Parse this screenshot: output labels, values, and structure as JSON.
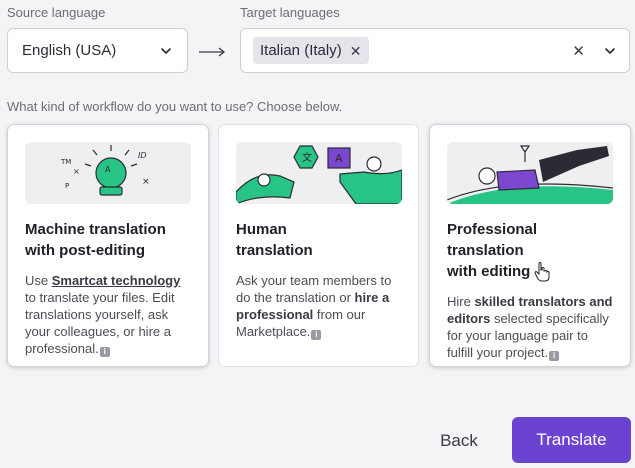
{
  "source": {
    "label": "Source language",
    "value": "English (USA)"
  },
  "target": {
    "label": "Target languages",
    "chip": "Italian (Italy)"
  },
  "question": "What kind of workflow do you want to use? Choose below.",
  "cards": [
    {
      "title": "Machine translation\nwith post-editing",
      "desc": [
        "Use ",
        "Smartcat technology",
        " to translate your files. Edit translations yourself, ask your colleagues, or hire a professional."
      ],
      "illustration": "crystal-ball",
      "icon_letters": [
        "TM",
        "ID",
        "P",
        "A"
      ]
    },
    {
      "title": "Human\ntranslation",
      "desc": [
        "Ask your team members to do the translation or ",
        "hire a professional",
        " from our Marketplace."
      ],
      "illustration": "people-exchanging-shapes",
      "icon_letters": [
        "A"
      ]
    },
    {
      "title": "Professional translation\nwith editing",
      "desc": [
        "Hire ",
        "skilled translators and editors",
        " selected specifically for your language pair to fulfill your project."
      ],
      "illustration": "person-relaxing"
    }
  ],
  "footer": {
    "back": "Back",
    "translate": "Translate"
  },
  "colors": {
    "accent": "#6a44d0",
    "illustration_green": "#27c486",
    "illustration_purple": "#7b47cf"
  }
}
